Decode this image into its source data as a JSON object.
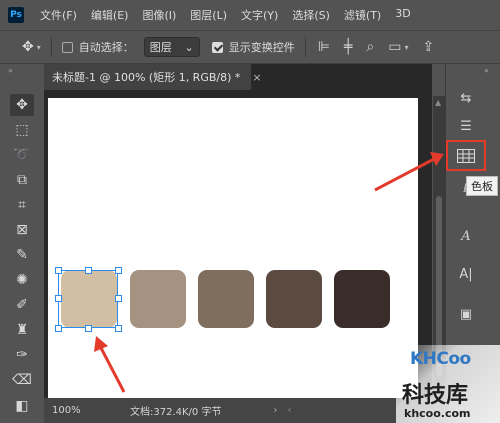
{
  "app": {
    "logo_text": "Ps"
  },
  "menu": {
    "items": [
      "文件(F)",
      "编辑(E)",
      "图像(I)",
      "图层(L)",
      "文字(Y)",
      "选择(S)",
      "滤镜(T)",
      "3D"
    ]
  },
  "options_bar": {
    "auto_select_label": "自动选择：",
    "auto_select_checked": false,
    "layer_select_value": "图层",
    "show_transform_label": "显示变换控件",
    "show_transform_checked": true
  },
  "document": {
    "tab_title": "未标题-1 @ 100% (矩形 1, RGB/8) *",
    "close_glyph": "×"
  },
  "swatches": {
    "colors": [
      "#d2bfa3",
      "#a59280",
      "#7f6e5d",
      "#5a4a3f",
      "#3a2d29"
    ],
    "selected_index": 0
  },
  "status": {
    "zoom": "100%",
    "doc_info": "文档:372.4K/0 字节",
    "chevron": "›"
  },
  "panels": {
    "tooltip": "色板",
    "highlight_color": "#e33a2c"
  },
  "watermark": {
    "logo": "KHCoo",
    "name": "科技库",
    "url": "khcoo.com"
  }
}
